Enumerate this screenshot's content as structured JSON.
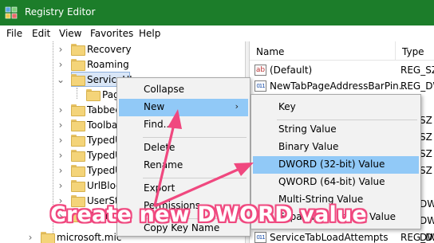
{
  "window": {
    "title": "Registry Editor",
    "titlebar_color": "#1c7d2a"
  },
  "menubar": {
    "items": [
      "File",
      "Edit",
      "View",
      "Favorites",
      "Help"
    ]
  },
  "tree": {
    "items": [
      {
        "label": "Recovery",
        "icon": "folder-icon"
      },
      {
        "label": "Roaming",
        "icon": "folder-icon"
      },
      {
        "label": "ServiceUI",
        "icon": "folder-icon",
        "state": "expanded-selected"
      },
      {
        "label": "Pag",
        "icon": "folder-icon"
      },
      {
        "label": "Tabbed",
        "icon": "folder-icon"
      },
      {
        "label": "Toolba",
        "icon": "folder-icon"
      },
      {
        "label": "TypedU",
        "icon": "folder-icon"
      },
      {
        "label": "TypedU",
        "icon": "folder-icon"
      },
      {
        "label": "TypedU",
        "icon": "folder-icon"
      },
      {
        "label": "UrlBloc",
        "icon": "folder-icon"
      },
      {
        "label": "UserSta",
        "icon": "folder-icon"
      },
      {
        "label": "Zoom",
        "icon": "folder-icon"
      },
      {
        "label": "microsoft.mic",
        "icon": "folder-icon"
      }
    ]
  },
  "list": {
    "headers": {
      "name": "Name",
      "type": "Type"
    },
    "rows": [
      {
        "icon": "string-value-icon",
        "name": "(Default)",
        "type": "REG_SZ"
      },
      {
        "icon": "binary-value-icon",
        "name": "NewTabPageAddressBarPin...",
        "type": "REG_DW"
      },
      {
        "icon": "binary-value-icon",
        "name": "",
        "type": ""
      },
      {
        "icon": "binary-value-icon",
        "name": "",
        "type": "SZ"
      },
      {
        "icon": "binary-value-icon",
        "name": "",
        "type": "SZ"
      },
      {
        "icon": "binary-value-icon",
        "name": "",
        "type": "SZ"
      },
      {
        "icon": "binary-value-icon",
        "name": "",
        "type": "SZ"
      },
      {
        "icon": "binary-value-icon",
        "name": "",
        "type": ""
      },
      {
        "icon": "binary-value-icon",
        "name": "",
        "type": "DW"
      },
      {
        "icon": "binary-value-icon",
        "name": "",
        "type": "DW"
      },
      {
        "icon": "binary-value-icon",
        "name": "",
        "type": "DW"
      },
      {
        "icon": "binary-value-icon",
        "name": "",
        "type": "DW"
      },
      {
        "icon": "binary-value-icon",
        "name": "ServiceTabLoadAttempts",
        "type": "REG_DW"
      }
    ]
  },
  "context_menu": {
    "items": [
      "Collapse",
      "New",
      "Find...",
      "Delete",
      "Rename",
      "Export",
      "Permissions...",
      "Copy Key Name"
    ],
    "highlighted": "New"
  },
  "submenu": {
    "items": [
      "Key",
      "String Value",
      "Binary Value",
      "DWORD (32-bit) Value",
      "QWORD (64-bit) Value",
      "Multi-String Value",
      "Expandable String Value"
    ],
    "highlighted": "DWORD (32-bit) Value"
  },
  "annotation": {
    "text": "Create new DWORD value",
    "color": "#f0487f"
  }
}
